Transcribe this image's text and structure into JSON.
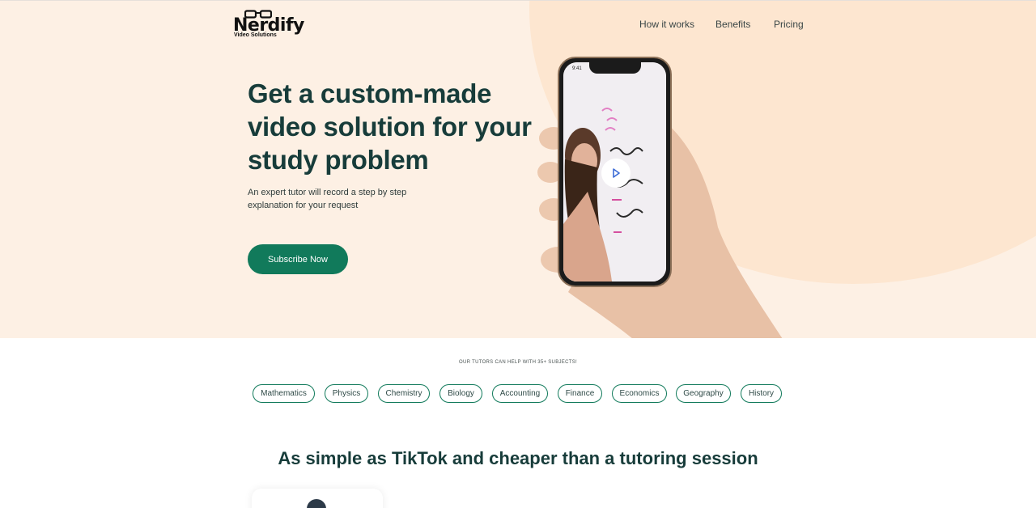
{
  "header": {
    "logo_word": "Nerdify",
    "logo_sub": "Video Solutions",
    "nav": [
      "How it works",
      "Benefits",
      "Pricing"
    ]
  },
  "hero": {
    "title": "Get a custom-made video solution for your study problem",
    "subtitle": "An expert tutor will record a step by step explanation for your request",
    "cta_label": "Subscribe Now",
    "phone_time": "9:41"
  },
  "subjects": {
    "caption": "OUR TUTORS CAN HELP WITH 35+ SUBJECTS!",
    "items": [
      "Mathematics",
      "Physics",
      "Chemistry",
      "Biology",
      "Accounting",
      "Finance",
      "Economics",
      "Geography",
      "History"
    ]
  },
  "section": {
    "title": "As simple as TikTok and cheaper than a tutoring session"
  },
  "colors": {
    "accent": "#117a5b",
    "hero_bg": "#fdf0e4",
    "heading": "#173c3a"
  },
  "icons": [
    "glasses-logo-icon",
    "play-icon"
  ]
}
